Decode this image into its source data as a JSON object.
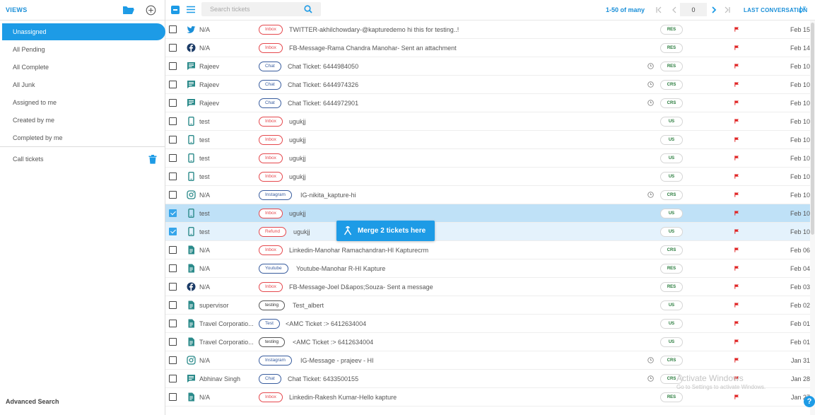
{
  "sidebar": {
    "title": "VIEWS",
    "items": [
      {
        "label": "Unassigned",
        "active": true
      },
      {
        "label": "All Pending"
      },
      {
        "label": "All Complete"
      },
      {
        "label": "All Junk"
      },
      {
        "label": "Assigned to me"
      },
      {
        "label": "Created by me"
      },
      {
        "label": "Completed by me"
      }
    ],
    "custom_view": "Call tickets",
    "advanced_search": "Advanced Search"
  },
  "toolbar": {
    "search_placeholder": "Search tickets",
    "pagination": "1-50 of many",
    "page_number": "0",
    "sort_label": "LAST CONVERSATION"
  },
  "tickets": [
    {
      "channel": "twitter-icon",
      "name": "N/A",
      "tag": "Inbox",
      "tag_color": "red",
      "subject": "TWITTER-akhilchowdary-@kapturedemo hi this for testing..!",
      "clock": false,
      "status": "RES",
      "date": "Feb 15",
      "checked": false
    },
    {
      "channel": "facebook-icon",
      "name": "N/A",
      "tag": "Inbox",
      "tag_color": "red",
      "subject": "FB-Message-Rama Chandra Manohar- Sent an attachment",
      "clock": false,
      "status": "RES",
      "date": "Feb 14",
      "checked": false
    },
    {
      "channel": "chat-icon",
      "name": "Rajeev",
      "tag": "Chat",
      "tag_color": "blue",
      "subject": "Chat Ticket: 6444984050",
      "clock": true,
      "status": "RES",
      "date": "Feb 10",
      "checked": false
    },
    {
      "channel": "chat-icon",
      "name": "Rajeev",
      "tag": "Chat",
      "tag_color": "blue",
      "subject": "Chat Ticket: 6444974326",
      "clock": true,
      "status": "CRS",
      "date": "Feb 10",
      "checked": false
    },
    {
      "channel": "chat-icon",
      "name": "Rajeev",
      "tag": "Chat",
      "tag_color": "blue",
      "subject": "Chat Ticket: 6444972901",
      "clock": true,
      "status": "CRS",
      "date": "Feb 10",
      "checked": false
    },
    {
      "channel": "mobile-icon",
      "name": "test",
      "tag": "Inbox",
      "tag_color": "red",
      "subject": "ugukjj",
      "clock": false,
      "status": "US",
      "date": "Feb 10",
      "checked": false
    },
    {
      "channel": "mobile-icon",
      "name": "test",
      "tag": "Inbox",
      "tag_color": "red",
      "subject": "ugukjj",
      "clock": false,
      "status": "US",
      "date": "Feb 10",
      "checked": false
    },
    {
      "channel": "mobile-icon",
      "name": "test",
      "tag": "Inbox",
      "tag_color": "red",
      "subject": "ugukjj",
      "clock": false,
      "status": "US",
      "date": "Feb 10",
      "checked": false
    },
    {
      "channel": "mobile-icon",
      "name": "test",
      "tag": "Inbox",
      "tag_color": "red",
      "subject": "ugukjj",
      "clock": false,
      "status": "US",
      "date": "Feb 10",
      "checked": false
    },
    {
      "channel": "instagram-icon",
      "name": "N/A",
      "tag": "Instagram",
      "tag_color": "blue",
      "subject": "IG-nikita_kapture-hi",
      "clock": true,
      "status": "CRS",
      "date": "Feb 10",
      "checked": false
    },
    {
      "channel": "mobile-icon",
      "name": "test",
      "tag": "Inbox",
      "tag_color": "red",
      "subject": "ugukjj",
      "clock": false,
      "status": "US",
      "date": "Feb 10",
      "checked": true
    },
    {
      "channel": "mobile-icon",
      "name": "test",
      "tag": "Refund",
      "tag_color": "red",
      "subject": "ugukjj",
      "clock": false,
      "status": "US",
      "date": "Feb 10",
      "checked": true
    },
    {
      "channel": "document-icon",
      "name": "N/A",
      "tag": "Inbox",
      "tag_color": "red",
      "subject": "Linkedin-Manohar Ramachandran-HI Kapturecrm",
      "clock": false,
      "status": "CRS",
      "date": "Feb 06",
      "checked": false
    },
    {
      "channel": "document-icon",
      "name": "N/A",
      "tag": "Youtube",
      "tag_color": "blue",
      "subject": "Youtube-Manohar R-HI Kapture",
      "clock": false,
      "status": "RES",
      "date": "Feb 04",
      "checked": false
    },
    {
      "channel": "facebook-icon",
      "name": "N/A",
      "tag": "Inbox",
      "tag_color": "red",
      "subject": "FB-Message-Joel D&apos;Souza- Sent a message",
      "clock": false,
      "status": "RES",
      "date": "Feb 03",
      "checked": false
    },
    {
      "channel": "document-icon",
      "name": "supervisor",
      "tag": "testing",
      "tag_color": "dark",
      "subject": "Test_albert",
      "clock": false,
      "status": "US",
      "date": "Feb 02",
      "checked": false
    },
    {
      "channel": "document-icon",
      "name": "Travel Corporatio...",
      "tag": "Test",
      "tag_color": "blue",
      "subject": "<AMC Ticket :> 6412634004",
      "clock": false,
      "status": "US",
      "date": "Feb 01",
      "checked": false
    },
    {
      "channel": "document-icon",
      "name": "Travel Corporatio...",
      "tag": "testing",
      "tag_color": "dark",
      "subject": "<AMC Ticket :> 6412634004",
      "clock": false,
      "status": "US",
      "date": "Feb 01",
      "checked": false
    },
    {
      "channel": "instagram-icon",
      "name": "N/A",
      "tag": "Instagram",
      "tag_color": "blue",
      "subject": "IG-Message - prajeev - HI",
      "clock": true,
      "status": "CRS",
      "date": "Jan 31",
      "checked": false
    },
    {
      "channel": "chat-icon",
      "name": "Abhinav Singh",
      "tag": "Chat",
      "tag_color": "blue",
      "subject": "Chat Ticket: 6433500155",
      "clock": true,
      "status": "CRS",
      "date": "Jan 28",
      "checked": false
    },
    {
      "channel": "document-icon",
      "name": "N/A",
      "tag": "Inbox",
      "tag_color": "red",
      "subject": "Linkedin-Rakesh Kumar-Hello kapture",
      "clock": false,
      "status": "RES",
      "date": "Jan 27",
      "checked": false
    }
  ],
  "merge_button": "Merge 2 tickets here",
  "watermark": {
    "title": "Activate Windows",
    "subtitle": "Go to Settings to activate Windows."
  },
  "help": "?",
  "colors": {
    "accent": "#1d9be6",
    "flag": "#e02424",
    "inbox_tag": "#e5484d",
    "chat_tag": "#385c9e"
  }
}
